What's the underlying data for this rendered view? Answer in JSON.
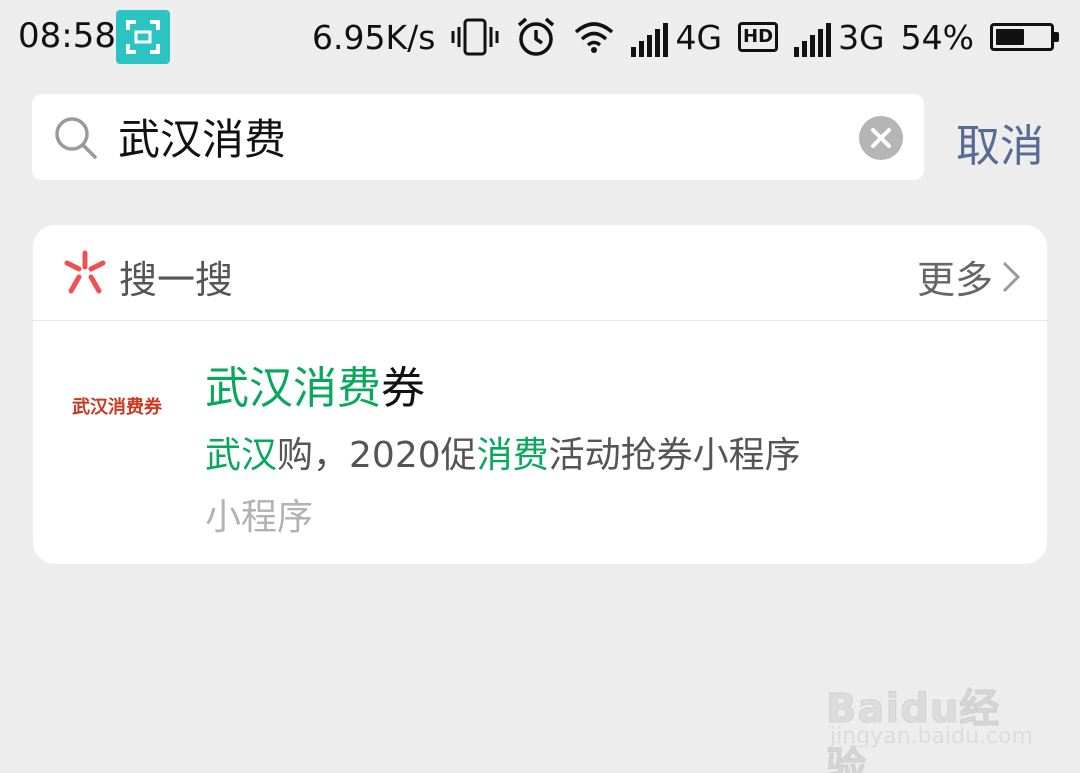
{
  "status_bar": {
    "time": "08:58",
    "speed": "6.95K/s",
    "network1": "4G",
    "hd": "HD",
    "network2": "3G",
    "battery": "54%",
    "battery_level": 0.54
  },
  "search": {
    "query": "武汉消费",
    "cancel_label": "取消"
  },
  "section": {
    "title": "搜一搜",
    "more_label": "更多"
  },
  "result": {
    "thumb_text": "武汉消费券",
    "title_hl": "武汉消费",
    "title_rest": "券",
    "desc_hl1": "武汉",
    "desc_mid": "购，2020促",
    "desc_hl2": "消费",
    "desc_rest": "活动抢券小程序",
    "type": "小程序"
  },
  "watermark": {
    "logo": "Baidu经验",
    "site": "jingyan.baidu.com"
  },
  "colors": {
    "highlight": "#07a85c",
    "link": "#576b95",
    "background": "#ededed"
  }
}
